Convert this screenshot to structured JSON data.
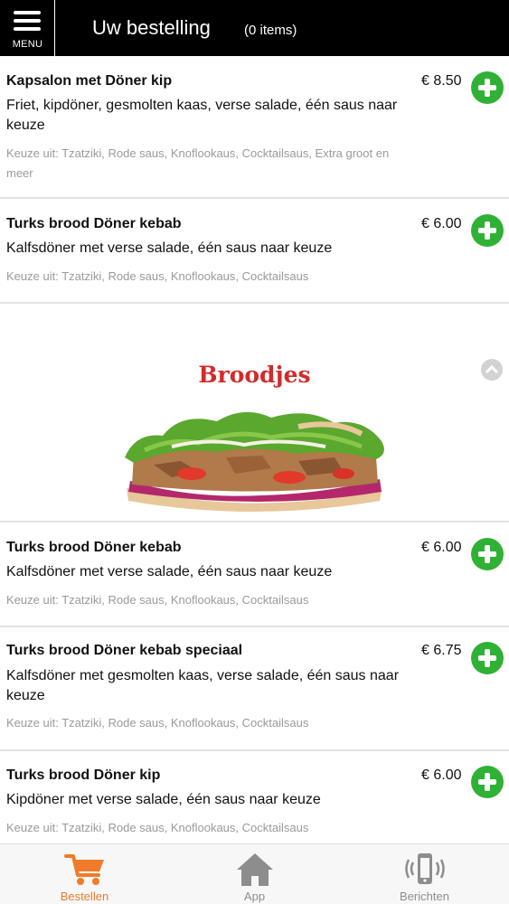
{
  "header": {
    "menu_label": "MENU",
    "title": "Uw bestelling",
    "item_count": "(0 items)"
  },
  "items_top": [
    {
      "name": "Kapsalon met Döner kip",
      "description": "Friet, kipdöner, gesmolten kaas, verse salade, één saus naar keuze",
      "options": "Keuze uit: Tzatziki, Rode saus, Knoflookaus, Cocktailsaus, Extra groot en meer",
      "price": "€ 8.50"
    },
    {
      "name": "Turks brood Döner kebab",
      "description": "Kalfsdöner met verse salade, één saus naar keuze",
      "options": "Keuze uit: Tzatziki, Rode saus, Knoflookaus, Cocktailsaus",
      "price": "€ 6.00"
    }
  ],
  "category": {
    "title": "Broodjes"
  },
  "items_bottom": [
    {
      "name": "Turks brood Döner kebab",
      "description": "Kalfsdöner met verse salade, één saus naar keuze",
      "options": "Keuze uit: Tzatziki, Rode saus, Knoflookaus, Cocktailsaus",
      "price": "€ 6.00"
    },
    {
      "name": "Turks brood Döner kebab speciaal",
      "description": "Kalfsdöner met gesmolten kaas, verse salade, één saus naar keuze",
      "options": "Keuze uit: Tzatziki, Rode saus, Knoflookaus, Cocktailsaus",
      "price": "€ 6.75"
    },
    {
      "name": "Turks brood Döner kip",
      "description": "Kipdöner met verse salade, één saus naar keuze",
      "options": "Keuze uit: Tzatziki, Rode saus, Knoflookaus, Cocktailsaus",
      "price": "€ 6.00"
    }
  ],
  "bottom_nav": [
    {
      "label": "Bestellen",
      "icon": "cart-icon",
      "active": true
    },
    {
      "label": "App",
      "icon": "home-icon",
      "active": false
    },
    {
      "label": "Berichten",
      "icon": "phone-icon",
      "active": false
    }
  ],
  "colors": {
    "header_bg": "#000000",
    "add_button": "#2fb135",
    "category_title": "#d42a2a",
    "nav_active": "#f07b2a",
    "nav_inactive": "#8d8d8d"
  }
}
